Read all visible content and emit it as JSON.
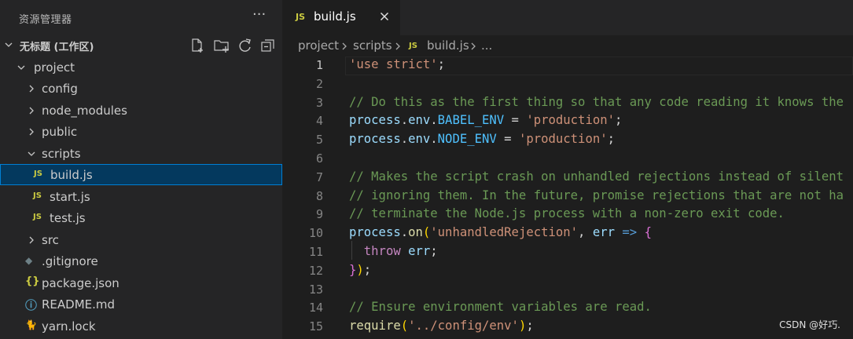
{
  "explorer": {
    "title": "资源管理器",
    "more": "···",
    "workspace_title": "无标题 (工作区)"
  },
  "tree": [
    {
      "label": "project",
      "kind": "folder-open"
    },
    {
      "label": "config",
      "kind": "folder"
    },
    {
      "label": "node_modules",
      "kind": "folder"
    },
    {
      "label": "public",
      "kind": "folder"
    },
    {
      "label": "scripts",
      "kind": "folder-open"
    },
    {
      "label": "build.js",
      "kind": "js",
      "selected": true
    },
    {
      "label": "start.js",
      "kind": "js"
    },
    {
      "label": "test.js",
      "kind": "js"
    },
    {
      "label": "src",
      "kind": "folder"
    },
    {
      "label": ".gitignore",
      "kind": "git"
    },
    {
      "label": "package.json",
      "kind": "json"
    },
    {
      "label": "README.md",
      "kind": "info"
    },
    {
      "label": "yarn.lock",
      "kind": "yarn"
    }
  ],
  "js_badge": "JS",
  "json_badge": "{}",
  "tab": {
    "label": "build.js"
  },
  "breadcrumbs": {
    "project": "project",
    "scripts": "scripts",
    "file": "build.js",
    "more": "..."
  },
  "code": {
    "active_line": 1,
    "lines": [
      {
        "n": "1",
        "t": [
          [
            "str",
            "'use strict'"
          ],
          [
            "plain",
            ";"
          ]
        ]
      },
      {
        "n": "2",
        "t": []
      },
      {
        "n": "3",
        "t": [
          [
            "cmt",
            "// Do this as the first thing so that any code reading it knows the"
          ]
        ]
      },
      {
        "n": "4",
        "t": [
          [
            "var",
            "process"
          ],
          [
            "plain",
            "."
          ],
          [
            "var",
            "env"
          ],
          [
            "plain",
            "."
          ],
          [
            "prop",
            "BABEL_ENV"
          ],
          [
            "plain",
            " = "
          ],
          [
            "str",
            "'production'"
          ],
          [
            "plain",
            ";"
          ]
        ]
      },
      {
        "n": "5",
        "t": [
          [
            "var",
            "process"
          ],
          [
            "plain",
            "."
          ],
          [
            "var",
            "env"
          ],
          [
            "plain",
            "."
          ],
          [
            "prop",
            "NODE_ENV"
          ],
          [
            "plain",
            " = "
          ],
          [
            "str",
            "'production'"
          ],
          [
            "plain",
            ";"
          ]
        ]
      },
      {
        "n": "6",
        "t": []
      },
      {
        "n": "7",
        "t": [
          [
            "cmt",
            "// Makes the script crash on unhandled rejections instead of silent"
          ]
        ]
      },
      {
        "n": "8",
        "t": [
          [
            "cmt",
            "// ignoring them. In the future, promise rejections that are not ha"
          ]
        ]
      },
      {
        "n": "9",
        "t": [
          [
            "cmt",
            "// terminate the Node.js process with a non-zero exit code."
          ]
        ]
      },
      {
        "n": "10",
        "t": [
          [
            "var",
            "process"
          ],
          [
            "plain",
            "."
          ],
          [
            "fn",
            "on"
          ],
          [
            "b1",
            "("
          ],
          [
            "str",
            "'unhandledRejection'"
          ],
          [
            "plain",
            ", "
          ],
          [
            "var",
            "err"
          ],
          [
            "plain",
            " "
          ],
          [
            "arrow",
            "=>"
          ],
          [
            "plain",
            " "
          ],
          [
            "b2",
            "{"
          ]
        ]
      },
      {
        "n": "11",
        "t": [
          [
            "plain",
            "  "
          ],
          [
            "kw",
            "throw"
          ],
          [
            "plain",
            " "
          ],
          [
            "var",
            "err"
          ],
          [
            "plain",
            ";"
          ]
        ]
      },
      {
        "n": "12",
        "t": [
          [
            "b2",
            "}"
          ],
          [
            "b1",
            ")"
          ],
          [
            "plain",
            ";"
          ]
        ]
      },
      {
        "n": "13",
        "t": []
      },
      {
        "n": "14",
        "t": [
          [
            "cmt",
            "// Ensure environment variables are read."
          ]
        ]
      },
      {
        "n": "15",
        "t": [
          [
            "fn",
            "require"
          ],
          [
            "b1",
            "("
          ],
          [
            "str",
            "'../config/env'"
          ],
          [
            "b1",
            ")"
          ],
          [
            "plain",
            ";"
          ]
        ]
      }
    ]
  },
  "watermark": "CSDN @好巧.",
  "colors": {
    "accent_selection": "#04395e",
    "focus_border": "#007fd4",
    "js_icon": "#cbcb41"
  }
}
